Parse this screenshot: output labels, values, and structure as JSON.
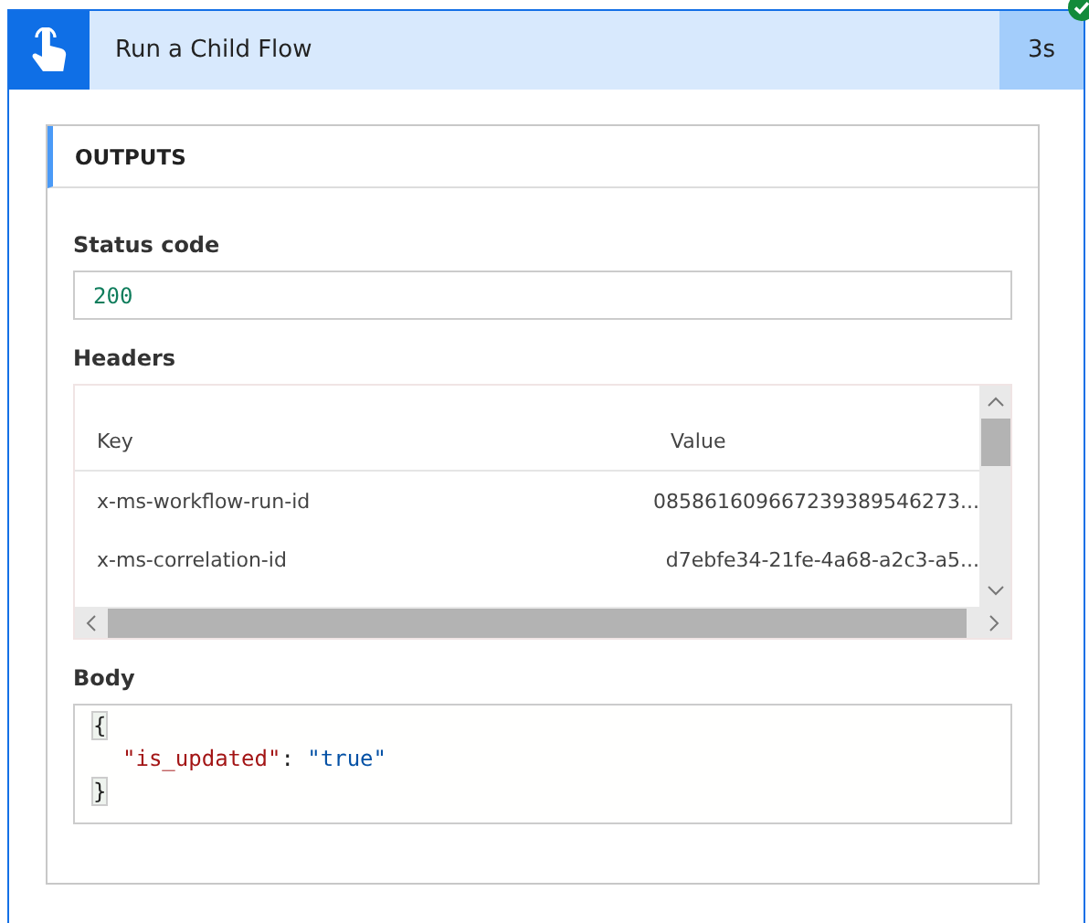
{
  "action": {
    "title": "Run a Child Flow",
    "duration": "3s",
    "succeeded": true
  },
  "outputs": {
    "title": "OUTPUTS",
    "status_code": {
      "label": "Status code",
      "value": "200"
    },
    "headers": {
      "label": "Headers",
      "columns": [
        "Key",
        "Value"
      ],
      "rows": [
        {
          "key": "x-ms-workflow-run-id",
          "value": "085861609667239389546273..."
        },
        {
          "key": "x-ms-correlation-id",
          "value": "d7ebfe34-21fe-4a68-a2c3-a5..."
        }
      ]
    },
    "body": {
      "label": "Body",
      "lines": [
        {
          "indent": false,
          "tokens": [
            {
              "kind": "brace",
              "text": "{"
            }
          ]
        },
        {
          "indent": true,
          "tokens": [
            {
              "kind": "key",
              "text": "\"is_updated\""
            },
            {
              "kind": "punct",
              "text": ": "
            },
            {
              "kind": "string",
              "text": "\"true\""
            }
          ]
        },
        {
          "indent": false,
          "tokens": [
            {
              "kind": "brace",
              "text": "}"
            }
          ]
        }
      ]
    }
  }
}
